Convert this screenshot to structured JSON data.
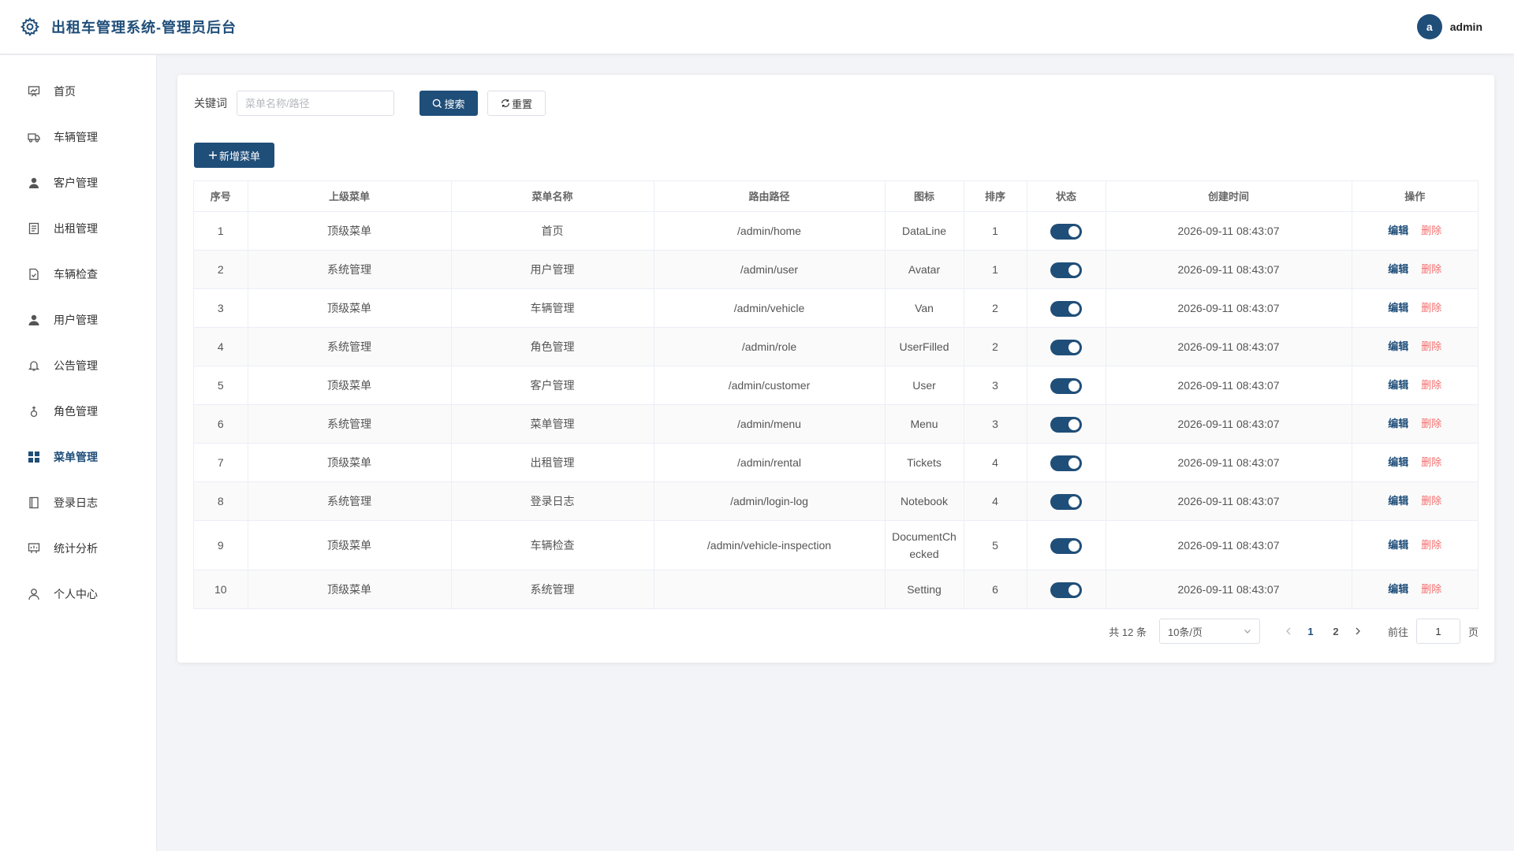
{
  "header": {
    "title": "出租车管理系统-管理员后台",
    "avatar_letter": "a",
    "username": "admin"
  },
  "sidebar": {
    "items": [
      {
        "label": "首页",
        "icon": "chart-board-icon"
      },
      {
        "label": "车辆管理",
        "icon": "van-icon"
      },
      {
        "label": "客户管理",
        "icon": "user-filled-icon"
      },
      {
        "label": "出租管理",
        "icon": "tickets-icon"
      },
      {
        "label": "车辆检查",
        "icon": "document-checked-icon"
      },
      {
        "label": "用户管理",
        "icon": "avatar-icon"
      },
      {
        "label": "公告管理",
        "icon": "bell-icon"
      },
      {
        "label": "角色管理",
        "icon": "stamp-icon"
      },
      {
        "label": "菜单管理",
        "icon": "menu-grid-icon",
        "active": true
      },
      {
        "label": "登录日志",
        "icon": "notebook-icon"
      },
      {
        "label": "统计分析",
        "icon": "data-board-icon"
      },
      {
        "label": "个人中心",
        "icon": "user-icon"
      }
    ]
  },
  "search": {
    "label": "关键词",
    "placeholder": "菜单名称/路径",
    "value": "",
    "search_label": "搜索",
    "reset_label": "重置",
    "add_label": "新增菜单"
  },
  "table": {
    "columns": [
      "序号",
      "上级菜单",
      "菜单名称",
      "路由路径",
      "图标",
      "排序",
      "状态",
      "创建时间",
      "操作"
    ],
    "edit_label": "编辑",
    "delete_label": "删除",
    "rows": [
      {
        "no": "1",
        "parent": "顶级菜单",
        "name": "首页",
        "path": "/admin/home",
        "icon": "DataLine",
        "sort": "1",
        "enabled": true,
        "created": "2026-09-11 08:43:07"
      },
      {
        "no": "2",
        "parent": "系统管理",
        "name": "用户管理",
        "path": "/admin/user",
        "icon": "Avatar",
        "sort": "1",
        "enabled": true,
        "created": "2026-09-11 08:43:07"
      },
      {
        "no": "3",
        "parent": "顶级菜单",
        "name": "车辆管理",
        "path": "/admin/vehicle",
        "icon": "Van",
        "sort": "2",
        "enabled": true,
        "created": "2026-09-11 08:43:07"
      },
      {
        "no": "4",
        "parent": "系统管理",
        "name": "角色管理",
        "path": "/admin/role",
        "icon": "UserFilled",
        "sort": "2",
        "enabled": true,
        "created": "2026-09-11 08:43:07"
      },
      {
        "no": "5",
        "parent": "顶级菜单",
        "name": "客户管理",
        "path": "/admin/customer",
        "icon": "User",
        "sort": "3",
        "enabled": true,
        "created": "2026-09-11 08:43:07"
      },
      {
        "no": "6",
        "parent": "系统管理",
        "name": "菜单管理",
        "path": "/admin/menu",
        "icon": "Menu",
        "sort": "3",
        "enabled": true,
        "created": "2026-09-11 08:43:07"
      },
      {
        "no": "7",
        "parent": "顶级菜单",
        "name": "出租管理",
        "path": "/admin/rental",
        "icon": "Tickets",
        "sort": "4",
        "enabled": true,
        "created": "2026-09-11 08:43:07"
      },
      {
        "no": "8",
        "parent": "系统管理",
        "name": "登录日志",
        "path": "/admin/login-log",
        "icon": "Notebook",
        "sort": "4",
        "enabled": true,
        "created": "2026-09-11 08:43:07"
      },
      {
        "no": "9",
        "parent": "顶级菜单",
        "name": "车辆检查",
        "path": "/admin/vehicle-inspection",
        "icon": "DocumentChecked",
        "sort": "5",
        "enabled": true,
        "created": "2026-09-11 08:43:07"
      },
      {
        "no": "10",
        "parent": "顶级菜单",
        "name": "系统管理",
        "path": "",
        "icon": "Setting",
        "sort": "6",
        "enabled": true,
        "created": "2026-09-11 08:43:07"
      }
    ]
  },
  "pagination": {
    "total_text": "共 12 条",
    "page_size": "10条/页",
    "pages": [
      "1",
      "2"
    ],
    "current_page": "1",
    "goto_label": "前往",
    "goto_value": "1",
    "page_unit": "页"
  },
  "colors": {
    "primary": "#1f4e79",
    "danger": "#f56c6c",
    "background": "#f3f4f7"
  }
}
